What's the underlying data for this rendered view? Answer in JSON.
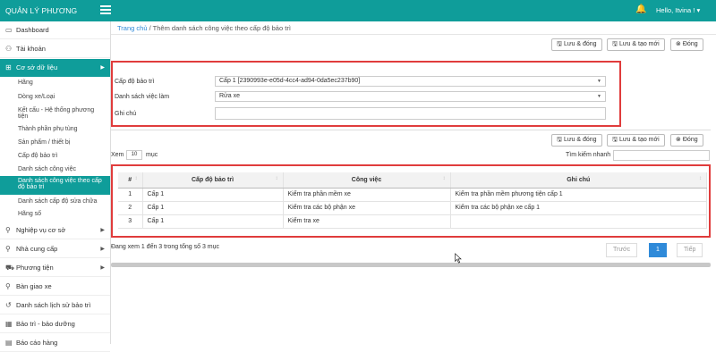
{
  "app": {
    "title": "QUẢN LÝ PHƯƠNG TIỆN",
    "user_greeting": "Hello, Itvina !"
  },
  "sidebar": {
    "dashboard": "Dashboard",
    "account": "Tài khoản",
    "database": "Cơ sở dữ liệu",
    "sub_items": [
      "Hãng",
      "Dòng xe/Loại",
      "Kết cấu - Hệ thống phương",
      "tiện",
      "Thành phần phụ tùng",
      "Sản phẩm / thiết bị",
      "Cấp độ bảo trì",
      "Danh sách công việc",
      "Danh sách công việc theo cấp",
      "độ bảo trì",
      "Danh sách cấp độ sửa chữa",
      "Hãng số"
    ],
    "business": "Nghiệp vụ cơ sở",
    "supplier": "Nhà cung cấp",
    "vehicle": "Phương tiện",
    "handover": "Bàn giao xe",
    "maintenance_history": "Danh sách lịch sử bảo trì",
    "maintenance": "Bảo trì - bảo dưỡng",
    "reports": "Báo cáo hàng"
  },
  "breadcrumb": {
    "home": "Trang chủ",
    "separator": "/",
    "current": "Thêm danh sách công việc theo cấp độ bảo trì"
  },
  "toolbar": {
    "save_close": "Lưu & đóng",
    "save_new": "Lưu & tạo mới",
    "close": "Đóng"
  },
  "form": {
    "level_label": "Cấp độ bảo trì",
    "level_value": "Cấp 1 [2390993e-e05d-4cc4-ad94-0da5ec237b90]",
    "tasks_label": "Danh sách việc làm",
    "tasks_value": "Rửa xe",
    "note_label": "Ghi chú",
    "note_value": ""
  },
  "list": {
    "show_label": "Xem",
    "page_size": "10",
    "items_label": "mục",
    "search_label": "Tìm kiếm nhanh",
    "columns": [
      "#",
      "Cấp độ bảo trì",
      "Công việc",
      "Ghi chú"
    ],
    "rows": [
      {
        "no": "1",
        "level": "Cấp 1",
        "task": "Kiểm tra phần mềm xe",
        "note": "Kiểm tra phần mềm phương tiện cấp 1"
      },
      {
        "no": "2",
        "level": "Cấp 1",
        "task": "Kiểm tra các bộ phận xe",
        "note": "Kiểm tra các bộ phận xe cấp 1"
      },
      {
        "no": "3",
        "level": "Cấp 1",
        "task": "Kiểm tra xe",
        "note": ""
      }
    ],
    "info": "Đang xem 1 đến 3 trong tổng số 3 mục",
    "prev": "Trước",
    "current_page": "1",
    "next": "Tiếp"
  }
}
